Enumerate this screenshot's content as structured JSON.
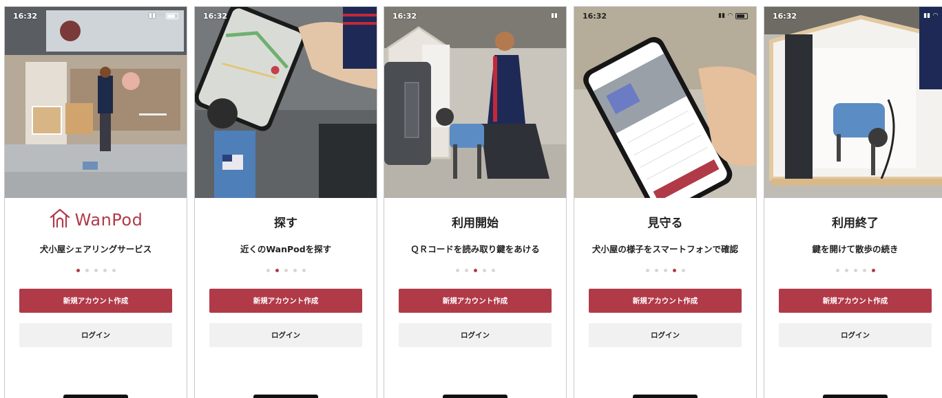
{
  "colors": {
    "accent": "#b13a48",
    "secondary_bg": "#f1f1f1"
  },
  "screens": [
    {
      "time": "16:32",
      "title": "",
      "logo_text": "WanPod",
      "subtitle": "犬小屋シェアリングサービス",
      "active_dot": 0,
      "primary_label": "新規アカウント作成",
      "secondary_label": "ログイン"
    },
    {
      "time": "16:32",
      "title": "探す",
      "subtitle": "近くのWanPodを探す",
      "active_dot": 1,
      "primary_label": "新規アカウント作成",
      "secondary_label": "ログイン"
    },
    {
      "time": "16:32",
      "title": "利用開始",
      "subtitle": "ＱＲコードを読み取り鍵をあける",
      "active_dot": 2,
      "primary_label": "新規アカウント作成",
      "secondary_label": "ログイン"
    },
    {
      "time": "16:32",
      "title": "見守る",
      "subtitle": "犬小屋の様子をスマートフォンで確認",
      "active_dot": 3,
      "primary_label": "新規アカウント作成",
      "secondary_label": "ログイン"
    },
    {
      "time": "16:32",
      "title": "利用終了",
      "subtitle": "鍵を開けて散歩の続き",
      "active_dot": 4,
      "primary_label": "新規アカウント作成",
      "secondary_label": "ログイン"
    }
  ]
}
